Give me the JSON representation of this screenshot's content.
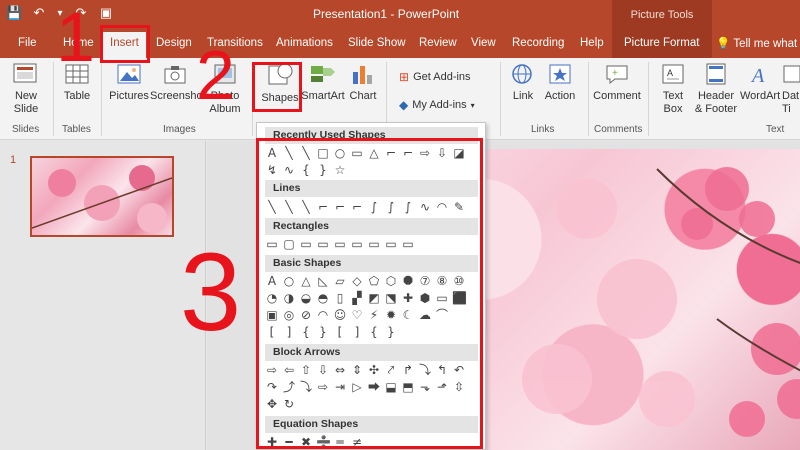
{
  "title_bar": {
    "title": "Presentation1  -  PowerPoint",
    "context_title": "Picture Tools",
    "qat": {
      "save": "💾",
      "undo": "↶",
      "undo_drop": "▾",
      "redo": "↷",
      "start": "▣"
    }
  },
  "tabs": [
    "File",
    "Home",
    "Insert",
    "Design",
    "Transitions",
    "Animations",
    "Slide Show",
    "Review",
    "View",
    "Recording",
    "Help",
    "Picture Format"
  ],
  "tell_me": "Tell me what",
  "ribbon": {
    "new_slide": "New\nSlide",
    "table": "Table",
    "pictures": "Pictures",
    "screenshot": "Screenshot",
    "photo_album": "Photo\nAlbum",
    "shapes": "Shapes",
    "smartart": "SmartArt",
    "chart": "Chart",
    "get_addins": "Get Add-ins",
    "my_addins": "My Add-ins",
    "link": "Link",
    "action": "Action",
    "comment": "Comment",
    "text_box": "Text\nBox",
    "header_footer": "Header\n& Footer",
    "wordart": "WordArt",
    "date_time": "Dat\nTi",
    "groups": {
      "slides": "Slides",
      "tables": "Tables",
      "images": "Images",
      "links": "Links",
      "comments": "Comments",
      "text": "Text"
    }
  },
  "thumbnail": {
    "number": "1"
  },
  "shapes_menu": {
    "sections": [
      {
        "title": "Recently Used Shapes",
        "shapes": [
          "A",
          "╲",
          "╲",
          "□",
          "○",
          "▭",
          "△",
          "⌐",
          "⌐",
          "⇨",
          "⇩",
          "◪",
          "↯",
          "∿",
          "{",
          "}",
          "☆"
        ]
      },
      {
        "title": "Lines",
        "shapes": [
          "╲",
          "╲",
          "╲",
          "⌐",
          "⌐",
          "⌐",
          "∫",
          "∫",
          "∫",
          "∿",
          "◠",
          "✎"
        ]
      },
      {
        "title": "Rectangles",
        "shapes": [
          "▭",
          "▢",
          "▭",
          "▭",
          "▭",
          "▭",
          "▭",
          "▭",
          "▭"
        ]
      },
      {
        "title": "Basic Shapes",
        "shapes": [
          "A",
          "○",
          "△",
          "◺",
          "▱",
          "◇",
          "⬠",
          "⬡",
          "⯃",
          "⑦",
          "⑧",
          "⑩",
          "◔",
          "◑",
          "◒",
          "◓",
          "▯",
          "▞",
          "◩",
          "⬔",
          "✚",
          "⬢",
          "▭",
          "⬛",
          "▣",
          "◎",
          "⊘",
          "◠",
          "☺",
          "♡",
          "⚡",
          "✹",
          "☾",
          "☁",
          "⌒",
          "[",
          "]",
          "{",
          "}",
          "[",
          "]",
          "{",
          "}"
        ]
      },
      {
        "title": "Block Arrows",
        "shapes": [
          "⇨",
          "⇦",
          "⇧",
          "⇩",
          "⇔",
          "⇕",
          "✣",
          "⤤",
          "↱",
          "⤵",
          "↰",
          "↶",
          "↷",
          "⤴",
          "⤵",
          "⇨",
          "⇥",
          "▷",
          "⮕",
          "⬓",
          "⬒",
          "⬎",
          "⬏",
          "⇳",
          "✥",
          "↻"
        ]
      },
      {
        "title": "Equation Shapes",
        "shapes": [
          "✚",
          "━",
          "✖",
          "➗",
          "═",
          "≠"
        ]
      }
    ]
  },
  "annotations": {
    "one": "1",
    "two": "2",
    "three": "3"
  },
  "colors": {
    "accent": "#b7472a",
    "annotation": "#e8141b"
  }
}
